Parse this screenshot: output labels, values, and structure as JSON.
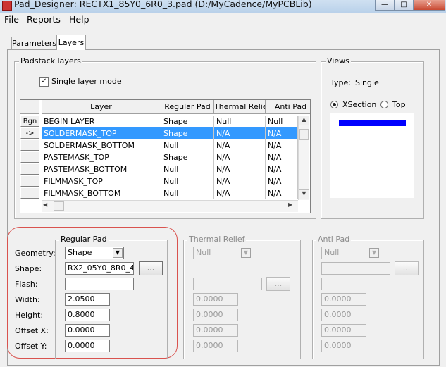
{
  "window": {
    "title": "Pad_Designer: RECTX1_85Y0_6R0_3.pad (D:/MyCadence/MyPCBLib)",
    "minimize_label": "—",
    "maximize_label": "□",
    "close_label": "✕"
  },
  "menu": {
    "file": "File",
    "reports": "Reports",
    "help": "Help"
  },
  "tabs": {
    "parameters": "Parameters",
    "layers": "Layers",
    "active": "Layers"
  },
  "padstack_layers": {
    "group_label": "Padstack layers",
    "single_layer_mode_label": "Single layer mode",
    "single_layer_mode_checked": true,
    "columns": [
      "Layer",
      "Regular Pad",
      "Thermal Relief",
      "Anti Pad"
    ],
    "header_button": "Bgn",
    "rows": [
      {
        "marker": "",
        "layer": "BEGIN LAYER",
        "regular": "Shape",
        "thermal": "Null",
        "anti": "Null",
        "selected": false
      },
      {
        "marker": "->",
        "layer": "SOLDERMASK_TOP",
        "regular": "Shape",
        "thermal": "N/A",
        "anti": "N/A",
        "selected": true
      },
      {
        "marker": "",
        "layer": "SOLDERMASK_BOTTOM",
        "regular": "Null",
        "thermal": "N/A",
        "anti": "N/A",
        "selected": false
      },
      {
        "marker": "",
        "layer": "PASTEMASK_TOP",
        "regular": "Shape",
        "thermal": "N/A",
        "anti": "N/A",
        "selected": false
      },
      {
        "marker": "",
        "layer": "PASTEMASK_BOTTOM",
        "regular": "Null",
        "thermal": "N/A",
        "anti": "N/A",
        "selected": false
      },
      {
        "marker": "",
        "layer": "FILMMASK_TOP",
        "regular": "Null",
        "thermal": "N/A",
        "anti": "N/A",
        "selected": false
      },
      {
        "marker": "",
        "layer": "FILMMASK_BOTTOM",
        "regular": "Null",
        "thermal": "N/A",
        "anti": "N/A",
        "selected": false
      }
    ]
  },
  "views": {
    "group_label": "Views",
    "type_label": "Type:",
    "type_value": "Single",
    "xsection_label": "XSection",
    "top_label": "Top",
    "selected_view": "XSection",
    "preview_bar_color": "#0000ff"
  },
  "regular_pad": {
    "group_label": "Regular Pad",
    "geometry_label": "Geometry:",
    "geometry_value": "Shape",
    "shape_label": "Shape:",
    "shape_value": "RX2_05Y0_8R0_4",
    "browse_label": "...",
    "flash_label": "Flash:",
    "flash_value": "",
    "width_label": "Width:",
    "width_value": "2.0500",
    "height_label": "Height:",
    "height_value": "0.8000",
    "offset_x_label": "Offset X:",
    "offset_x_value": "0.0000",
    "offset_y_label": "Offset Y:",
    "offset_y_value": "0.0000"
  },
  "thermal_relief": {
    "group_label": "Thermal Relief",
    "geometry_value": "Null",
    "browse_label": "...",
    "width_value": "0.0000",
    "height_value": "0.0000",
    "offset_x_value": "0.0000",
    "offset_y_value": "0.0000"
  },
  "anti_pad": {
    "group_label": "Anti Pad",
    "geometry_value": "Null",
    "browse_label": "...",
    "width_value": "0.0000",
    "height_value": "0.0000",
    "offset_x_value": "0.0000",
    "offset_y_value": "0.0000"
  },
  "colors": {
    "selection": "#3399ff",
    "annotation": "#d9534f"
  }
}
